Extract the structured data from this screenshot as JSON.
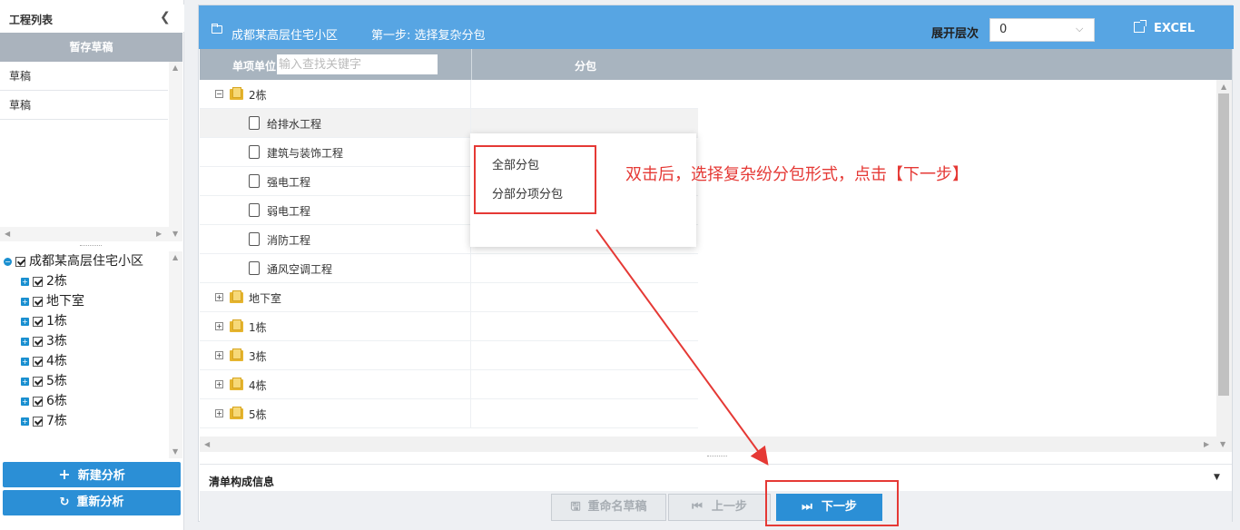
{
  "sidebar": {
    "title": "工程列表",
    "drafts_header": "暂存草稿",
    "drafts": [
      "草稿",
      "草稿"
    ],
    "tree": [
      {
        "label": "成都某高层住宅小区"
      },
      {
        "label": "2栋"
      },
      {
        "label": "地下室"
      },
      {
        "label": "1栋"
      },
      {
        "label": "3栋"
      },
      {
        "label": "4栋"
      },
      {
        "label": "5栋"
      },
      {
        "label": "6栋"
      },
      {
        "label": "7栋"
      }
    ],
    "new_analysis": "新建分析",
    "reanalyze": "重新分析"
  },
  "header": {
    "project": "成都某高层住宅小区",
    "step": "第一步: 选择复杂分包",
    "expand_label": "展开层次",
    "expand_value": "0",
    "excel": "EXCEL"
  },
  "grid": {
    "col1": "单项单位",
    "search_placeholder": "输入查找关键字",
    "col2": "分包",
    "rows": [
      {
        "label": "2栋",
        "kind": "folder",
        "expanded": true
      },
      {
        "label": "给排水工程",
        "kind": "doc"
      },
      {
        "label": "建筑与装饰工程",
        "kind": "doc"
      },
      {
        "label": "强电工程",
        "kind": "doc"
      },
      {
        "label": "弱电工程",
        "kind": "doc"
      },
      {
        "label": "消防工程",
        "kind": "doc"
      },
      {
        "label": "通风空调工程",
        "kind": "doc"
      },
      {
        "label": "地下室",
        "kind": "folder",
        "expanded": false
      },
      {
        "label": "1栋",
        "kind": "folder",
        "expanded": false
      },
      {
        "label": "3栋",
        "kind": "folder",
        "expanded": false
      },
      {
        "label": "4栋",
        "kind": "folder",
        "expanded": false
      },
      {
        "label": "5栋",
        "kind": "folder",
        "expanded": false
      }
    ]
  },
  "popup": {
    "items": [
      "全部分包",
      "分部分项分包"
    ]
  },
  "annotation": "双击后，选择复杂纷分包形式，点击【下一步】",
  "info_bar": {
    "label": "清单构成信息"
  },
  "footer": {
    "rename": "重命名草稿",
    "prev": "上一步",
    "next": "下一步"
  },
  "colors": {
    "header_blue": "#57a5e3",
    "button_blue": "#2b8fd6",
    "annotation_red": "#e53935",
    "grid_header": "#a8b4bf"
  }
}
